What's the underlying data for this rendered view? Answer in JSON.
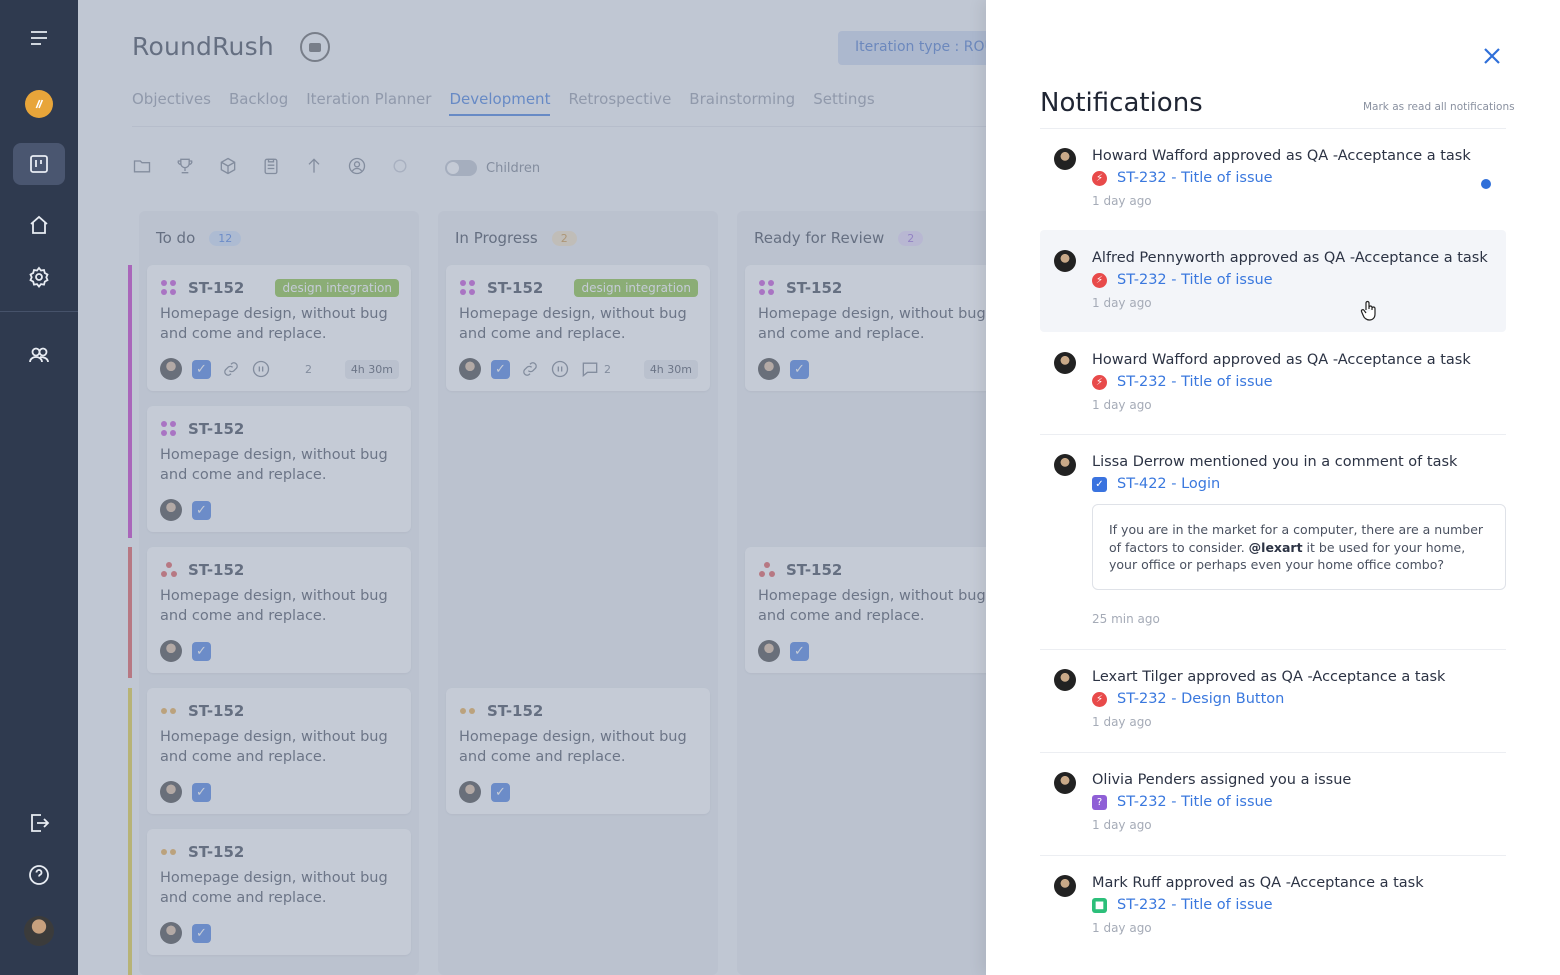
{
  "app": {
    "project_title": "RoundRush",
    "iteration_type": "Iteration type : ROUND",
    "tabs": [
      "Objectives",
      "Backlog",
      "Iteration Planner",
      "Development",
      "Retrospective",
      "Brainstorming",
      "Settings"
    ],
    "active_tab": "Development",
    "children_toggle_label": "Children"
  },
  "board": {
    "columns": [
      {
        "title": "To do",
        "count": "12",
        "badge_color": "#6aa0e8"
      },
      {
        "title": "In Progress",
        "count": "2",
        "badge_color": "#e6b46a"
      },
      {
        "title": "Ready for Review",
        "count": "2",
        "badge_color": "#b18ae6"
      }
    ],
    "card": {
      "id": "ST-152",
      "text": "Homepage design, without bug and come and replace.",
      "tag": "design integration",
      "comments": "2",
      "time": "4h 30m"
    },
    "lane_colors": [
      "#c21fc2",
      "#e04848",
      "#e0c92a"
    ]
  },
  "notifications": {
    "title": "Notifications",
    "mark_all_read": "Mark as read all notifications",
    "items": [
      {
        "text": "Howard Wafford approved as QA -Acceptance a task",
        "link": "ST-232 - Title of issue",
        "time": "1 day ago",
        "type": "bug",
        "type_color": "#e84a4a"
      },
      {
        "text": "Alfred Pennyworth approved as QA -Acceptance a task",
        "link": "ST-232 - Title of issue",
        "time": "1 day ago",
        "type": "bug",
        "type_color": "#e84a4a"
      },
      {
        "text": "Howard Wafford approved as QA -Acceptance a task",
        "link": "ST-232 - Title of issue",
        "time": "1 day ago",
        "type": "bug",
        "type_color": "#e84a4a"
      },
      {
        "text": "Lissa Derrow mentioned you in a comment of task",
        "link": "ST-422 - Login",
        "time": "25 min ago",
        "type": "task",
        "type_color": "#3a73df",
        "comment_before": "If you are in the market for a computer, there are a number of factors to consider. ",
        "comment_mention": "@lexart",
        "comment_after": " it be used for your home, your office or perhaps even your home office combo?"
      },
      {
        "text": "Lexart Tilger approved as QA -Acceptance a task",
        "link": "ST-232 - Design Button",
        "time": "1 day ago",
        "type": "bug",
        "type_color": "#e84a4a"
      },
      {
        "text": "Olivia Penders assigned you a issue",
        "link": "ST-232 - Title of issue",
        "time": "1 day ago",
        "type": "question",
        "type_color": "#8f5fd6"
      },
      {
        "text": "Mark Ruff approved as QA -Acceptance a task",
        "link": "ST-232 - Title of issue",
        "time": "1 day ago",
        "type": "story",
        "type_color": "#2cbf7a"
      }
    ]
  }
}
